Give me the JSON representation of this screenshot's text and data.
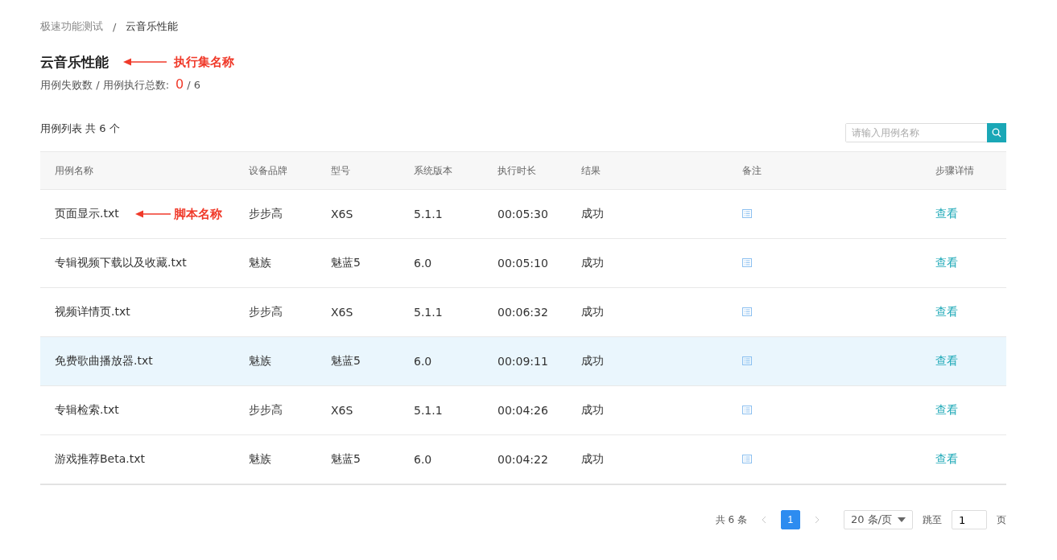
{
  "breadcrumb": [
    {
      "label": "极速功能测试",
      "selected": false
    },
    {
      "label": "云音乐性能",
      "selected": true
    }
  ],
  "breadcrumb_separator": "/",
  "title": "云音乐性能",
  "title_annotation": "执行集名称",
  "summary": {
    "label": "用例失败数 / 用例执行总数:",
    "failed": "0",
    "total": "/ 6"
  },
  "list_title": "用例列表 共 6 个",
  "search": {
    "placeholder": "请输入用例名称"
  },
  "table": {
    "columns": [
      "用例名称",
      "设备品牌",
      "型号",
      "系统版本",
      "执行时长",
      "结果",
      "备注",
      "步骤详情"
    ],
    "name_annotation": "脚本名称",
    "rows": [
      {
        "name": "页面显示.txt",
        "brand": "步步高",
        "model": "X6S",
        "os": "5.1.1",
        "duration": "00:05:30",
        "result": "成功",
        "action": "查看",
        "selected": false
      },
      {
        "name": "专辑视频下载以及收藏.txt",
        "brand": "魅族",
        "model": "魅蓝5",
        "os": "6.0",
        "duration": "00:05:10",
        "result": "成功",
        "action": "查看",
        "selected": false
      },
      {
        "name": "视频详情页.txt",
        "brand": "步步高",
        "model": "X6S",
        "os": "5.1.1",
        "duration": "00:06:32",
        "result": "成功",
        "action": "查看",
        "selected": false
      },
      {
        "name": "免费歌曲播放器.txt",
        "brand": "魅族",
        "model": "魅蓝5",
        "os": "6.0",
        "duration": "00:09:11",
        "result": "成功",
        "action": "查看",
        "selected": true
      },
      {
        "name": "专辑检索.txt",
        "brand": "步步高",
        "model": "X6S",
        "os": "5.1.1",
        "duration": "00:04:26",
        "result": "成功",
        "action": "查看",
        "selected": false
      },
      {
        "name": "游戏推荐Beta.txt",
        "brand": "魅族",
        "model": "魅蓝5",
        "os": "6.0",
        "duration": "00:04:22",
        "result": "成功",
        "action": "查看",
        "selected": false
      }
    ]
  },
  "pagination": {
    "total": "共 6 条",
    "pages": [
      {
        "label": "1",
        "selected": true
      }
    ],
    "page_size": "20 条/页",
    "jump_label": "跳至",
    "jump_value": "1",
    "page_suffix": "页"
  }
}
